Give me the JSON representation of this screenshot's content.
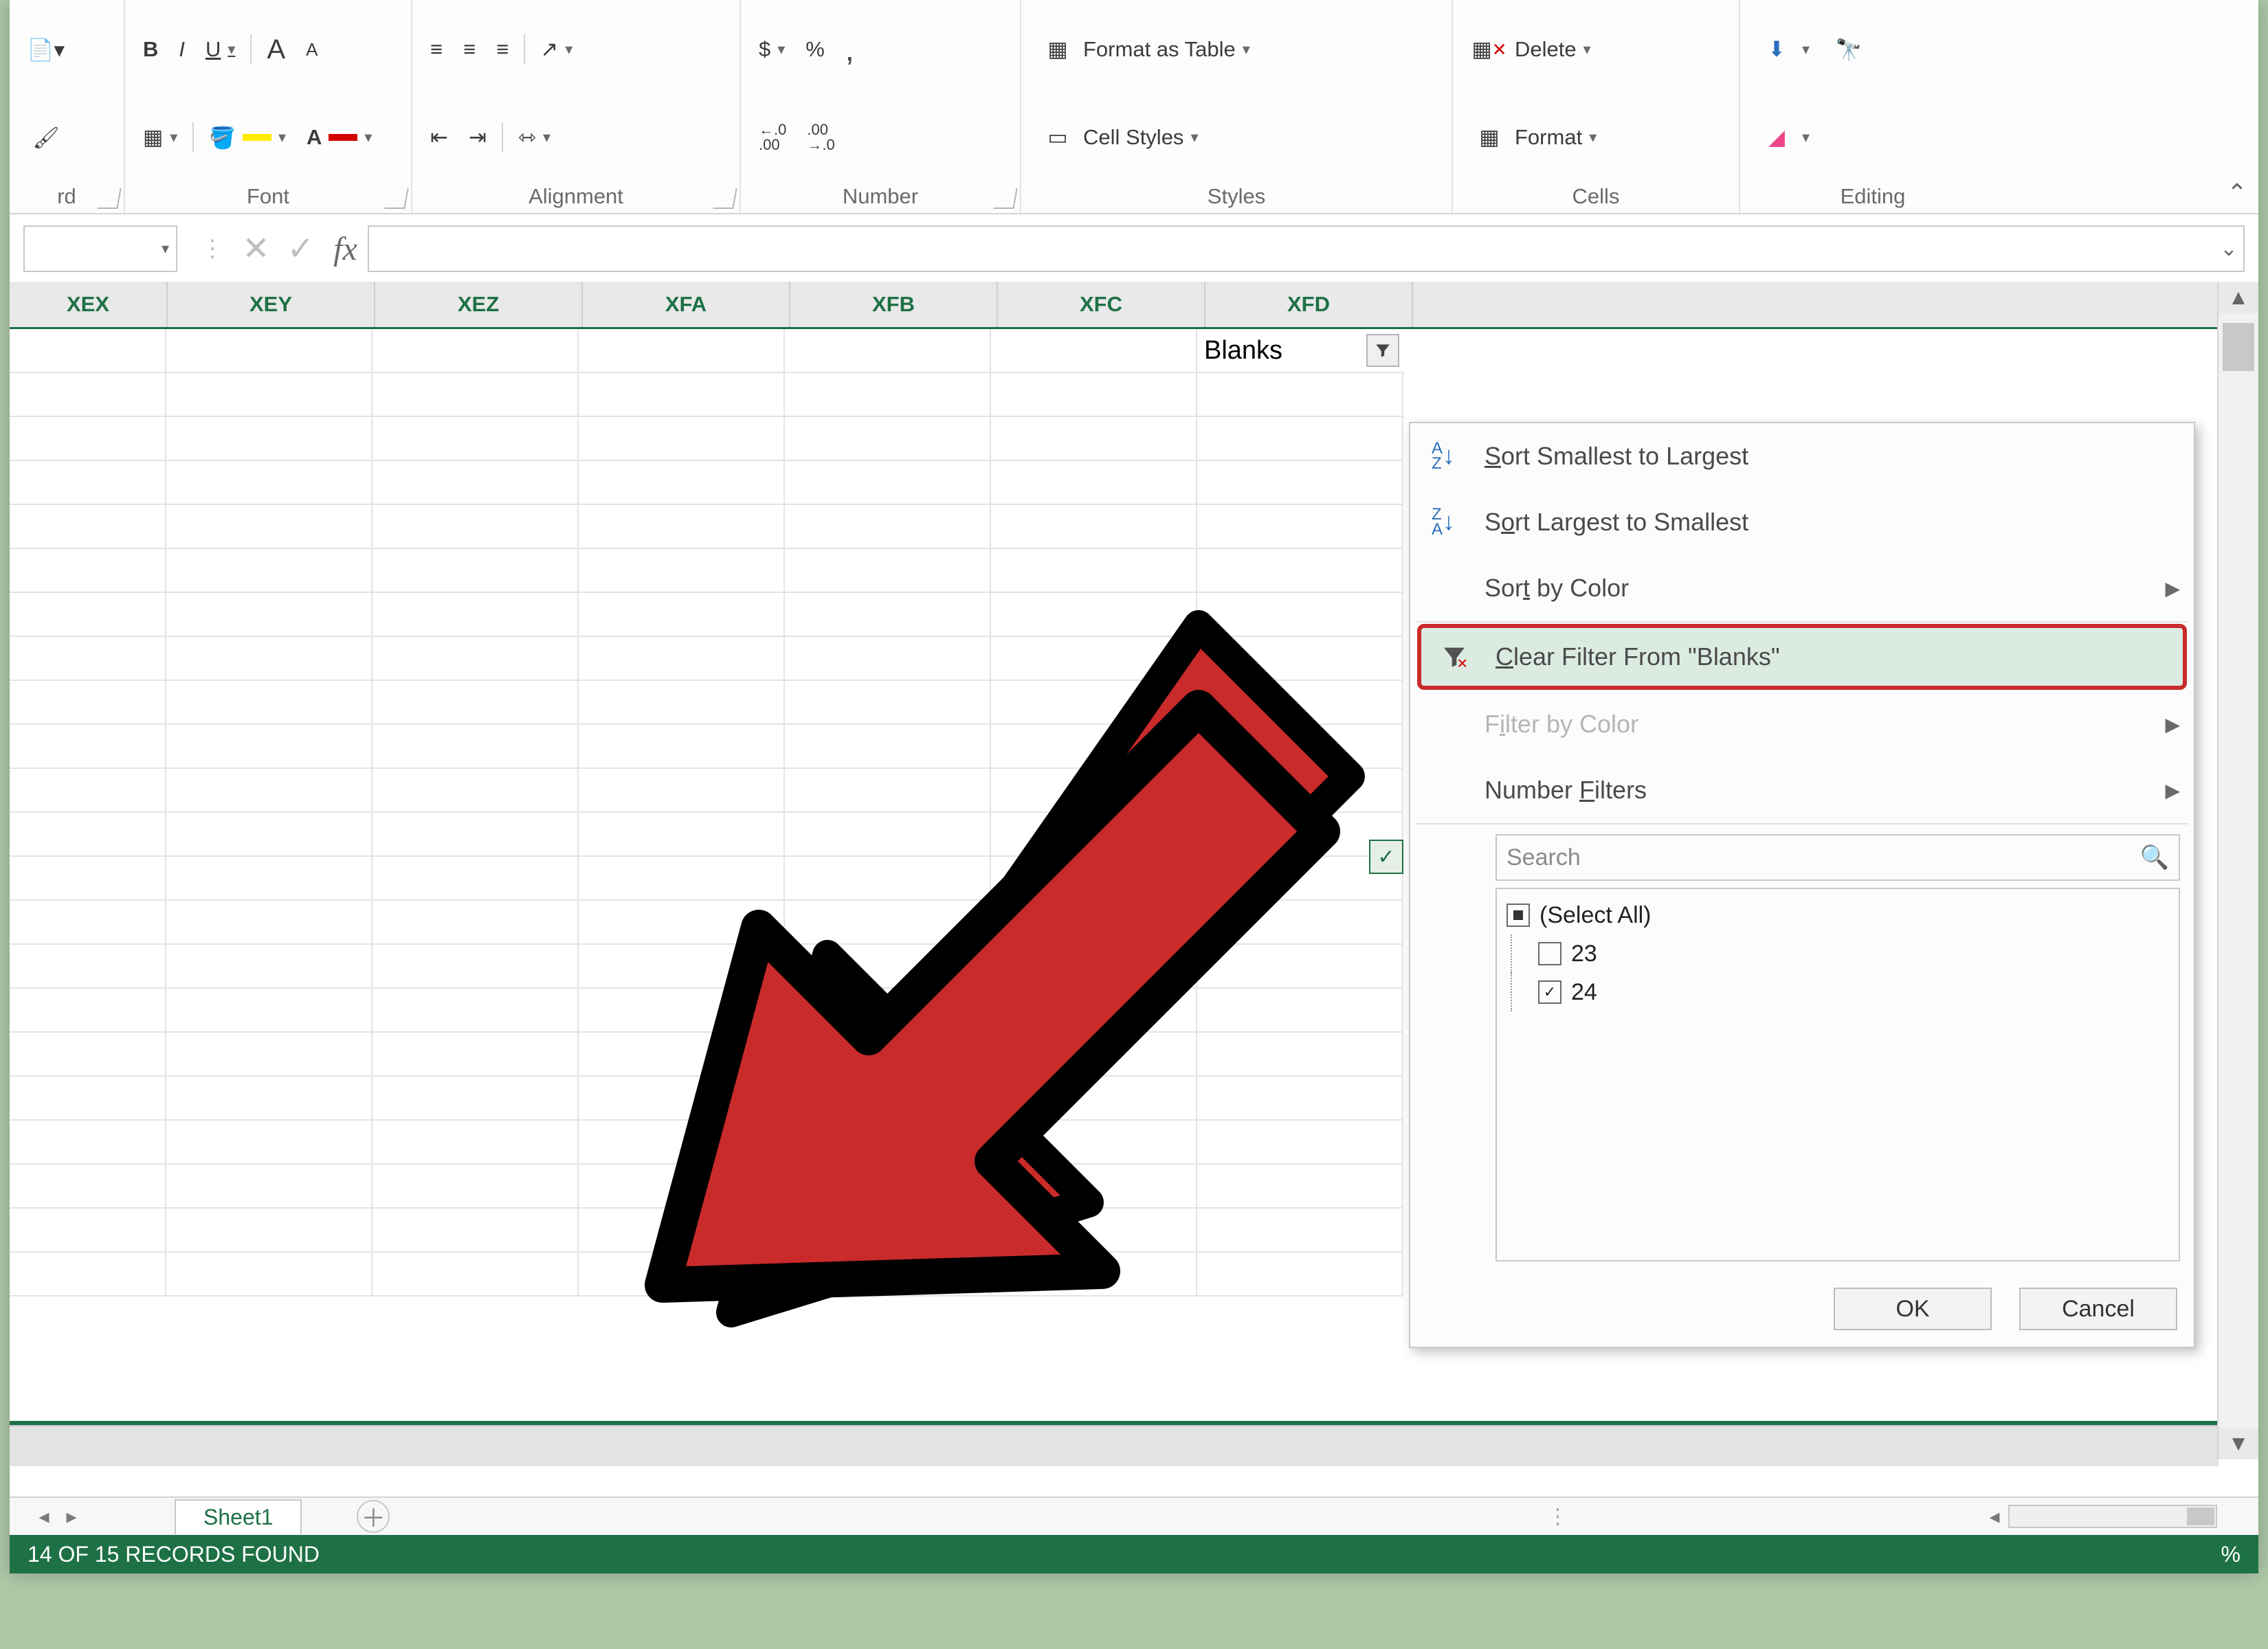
{
  "ribbon": {
    "font": {
      "bold": "B",
      "italic": "I",
      "underline": "U",
      "increase": "A",
      "decrease": "A",
      "group_label": "Font"
    },
    "alignment": {
      "group_label": "Alignment"
    },
    "number": {
      "currency": "$",
      "percent": "%",
      "comma": ",",
      "inc_dec_left": ".0",
      "inc_dec_right": ".00",
      "group_label": "Number"
    },
    "styles": {
      "format_as_table": "Format as Table",
      "cell_styles": "Cell Styles",
      "group_label": "Styles"
    },
    "cells": {
      "delete": "Delete",
      "format": "Format",
      "group_label": "Cells"
    },
    "editing": {
      "group_label": "Editing"
    },
    "clipboard_label": "rd"
  },
  "formula_bar": {
    "fx": "fx",
    "value": ""
  },
  "columns": [
    "XEX",
    "XEY",
    "XEZ",
    "XFA",
    "XFB",
    "XFC",
    "XFD"
  ],
  "filter_cell_label": "Blanks",
  "sheet_tab": "Sheet1",
  "status_text": "14 OF 15 RECORDS FOUND",
  "zoom_suffix": "%",
  "filter_menu": {
    "sort_asc": "Sort Smallest to Largest",
    "sort_desc": "Sort Largest to Smallest",
    "sort_color": "Sort by Color",
    "clear_filter": "Clear Filter From \"Blanks\"",
    "filter_color": "Filter by Color",
    "number_filters": "Number Filters",
    "search_placeholder": "Search",
    "select_all": "(Select All)",
    "item1": "23",
    "item2": "24",
    "ok": "OK",
    "cancel": "Cancel"
  }
}
